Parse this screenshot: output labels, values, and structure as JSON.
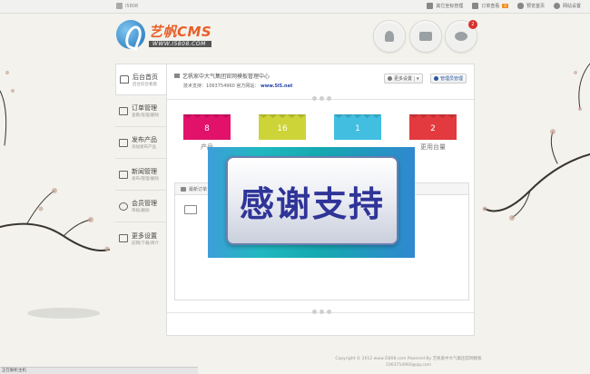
{
  "topbar": {
    "user": "i5808",
    "nav": [
      {
        "label": "其它坐标管理",
        "icon": "document-icon"
      },
      {
        "label": "订单查看",
        "badge": "0",
        "icon": "order-icon"
      },
      {
        "label": "预览首页",
        "icon": "cloud-icon"
      },
      {
        "label": "网站设置",
        "icon": "gear-icon"
      }
    ]
  },
  "logo": {
    "name": "艺帆CMS",
    "url": "WWW.I5808.COM"
  },
  "header_buttons": {
    "badge": "2"
  },
  "sidebar": [
    {
      "title": "后台首页",
      "sub": "后台综合看看"
    },
    {
      "title": "订单管理",
      "sub": "查看/处理/删除"
    },
    {
      "title": "发布产品",
      "sub": "添加发布产品"
    },
    {
      "title": "新闻管理",
      "sub": "发布/管理/删除"
    },
    {
      "title": "会员管理",
      "sub": "审核/删除"
    },
    {
      "title": "更多设置",
      "sub": "前网/下载/简介"
    }
  ],
  "main": {
    "welcome": "艺帆家中大气集团官网模板管理中心",
    "support_label": "技术支持：",
    "support": "1063754960 官方网站：",
    "support_url": "www.5l5.net",
    "btn_more": "更多设置",
    "btn_admin": "管理员管理",
    "tiles": [
      {
        "value": "8",
        "label": "产品",
        "color": "#e2126a"
      },
      {
        "value": "16",
        "label": "",
        "color": "#cdd437"
      },
      {
        "value": "1",
        "label": "",
        "color": "#41bee0"
      },
      {
        "value": "2",
        "label": "更用台量",
        "color": "#e23a3e"
      }
    ],
    "panel_title": "最新订单"
  },
  "overlay": {
    "text": "感谢支持"
  },
  "footer": {
    "line1": "Copyright © 2012 www.i5808.com Powered By 艺帆家中大气集团官网模板",
    "line2": "1063754960@qq.com"
  },
  "status_bar": "正在解析主机"
}
